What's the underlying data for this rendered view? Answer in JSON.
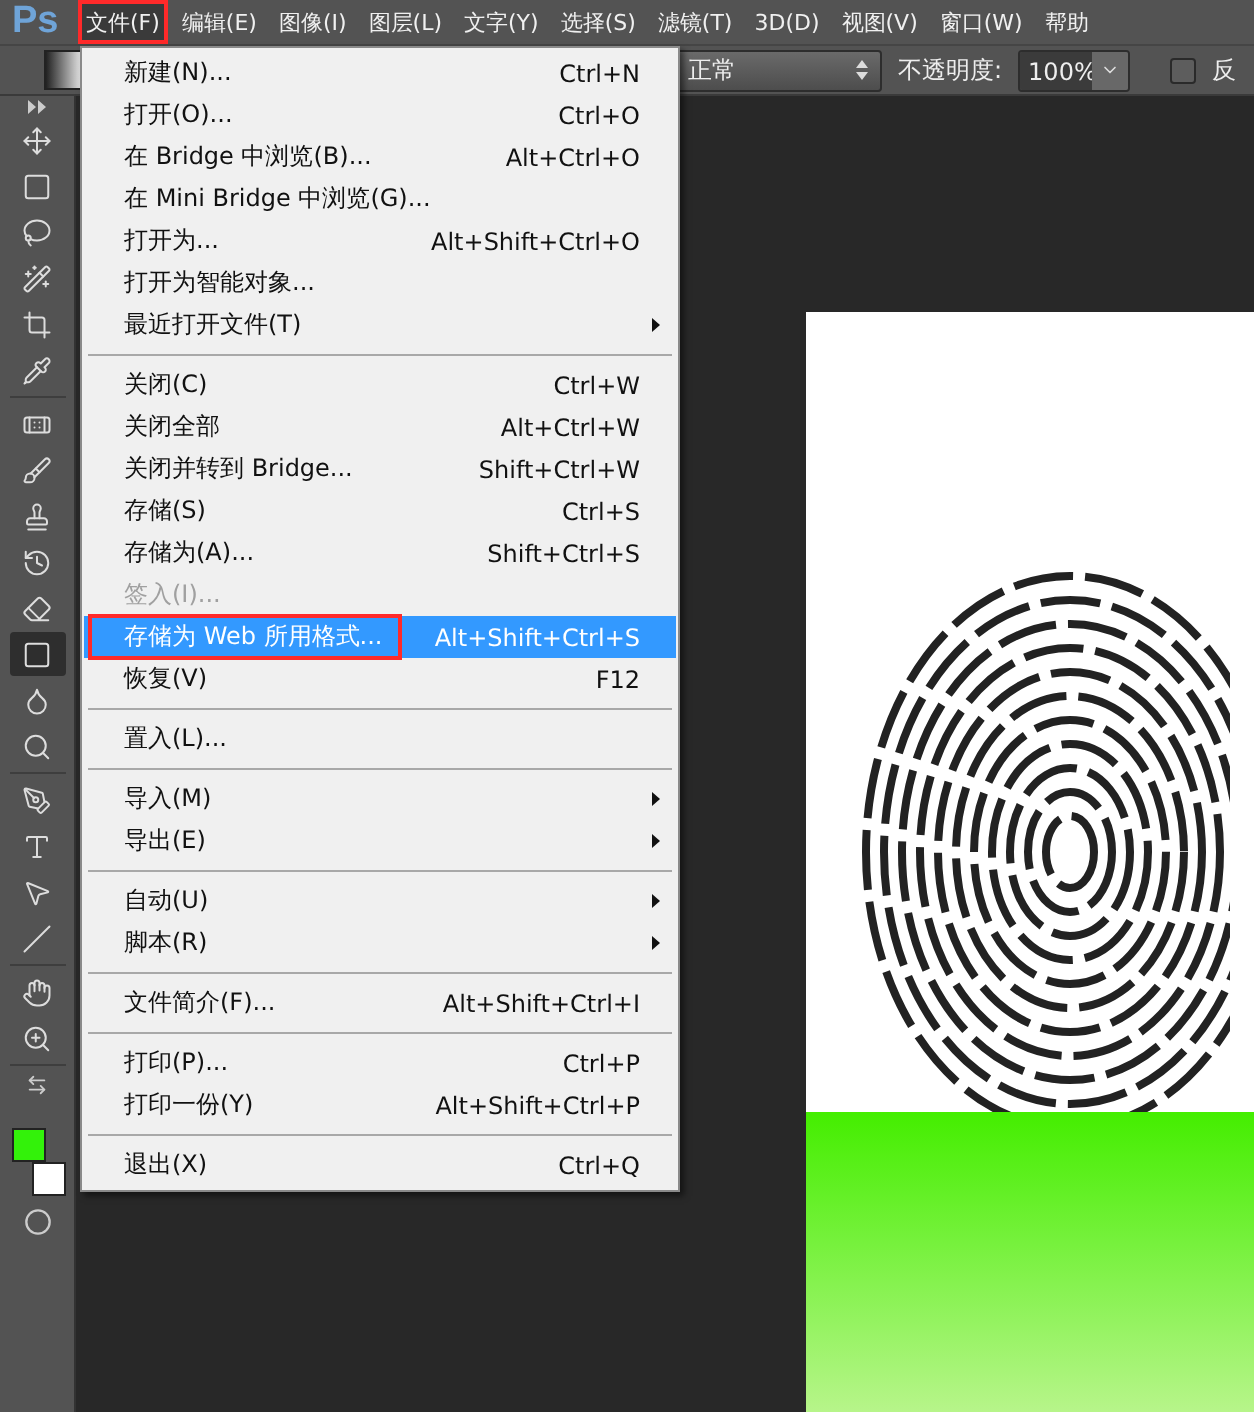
{
  "app": {
    "logo": "Ps"
  },
  "menubar": [
    {
      "label": "文件(F)",
      "selected": true,
      "annotated": true
    },
    {
      "label": "编辑(E)",
      "selected": false,
      "annotated": false
    },
    {
      "label": "图像(I)",
      "selected": false,
      "annotated": false
    },
    {
      "label": "图层(L)",
      "selected": false,
      "annotated": false
    },
    {
      "label": "文字(Y)",
      "selected": false,
      "annotated": false
    },
    {
      "label": "选择(S)",
      "selected": false,
      "annotated": false
    },
    {
      "label": "滤镜(T)",
      "selected": false,
      "annotated": false
    },
    {
      "label": "3D(D)",
      "selected": false,
      "annotated": false
    },
    {
      "label": "视图(V)",
      "selected": false,
      "annotated": false
    },
    {
      "label": "窗口(W)",
      "selected": false,
      "annotated": false
    },
    {
      "label": "帮助",
      "selected": false,
      "annotated": false
    }
  ],
  "options_bar": {
    "blend_mode": "正常",
    "opacity_label": "不透明度:",
    "opacity_value": "100%",
    "reverse_checked": false,
    "reverse_label": "反"
  },
  "file_menu": {
    "groups": [
      [
        {
          "label": "新建(N)...",
          "shortcut": "Ctrl+N",
          "submenu": false,
          "disabled": false,
          "selected": false,
          "annotated": false
        },
        {
          "label": "打开(O)...",
          "shortcut": "Ctrl+O",
          "submenu": false,
          "disabled": false,
          "selected": false,
          "annotated": false
        },
        {
          "label": "在 Bridge 中浏览(B)...",
          "shortcut": "Alt+Ctrl+O",
          "submenu": false,
          "disabled": false,
          "selected": false,
          "annotated": false
        },
        {
          "label": "在 Mini Bridge 中浏览(G)...",
          "submenu": false,
          "disabled": false,
          "selected": false,
          "annotated": false
        },
        {
          "label": "打开为...",
          "shortcut": "Alt+Shift+Ctrl+O",
          "submenu": false,
          "disabled": false,
          "selected": false,
          "annotated": false
        },
        {
          "label": "打开为智能对象...",
          "submenu": false,
          "disabled": false,
          "selected": false,
          "annotated": false
        },
        {
          "label": "最近打开文件(T)",
          "submenu": true,
          "disabled": false,
          "selected": false,
          "annotated": false
        }
      ],
      [
        {
          "label": "关闭(C)",
          "shortcut": "Ctrl+W",
          "submenu": false,
          "disabled": false,
          "selected": false,
          "annotated": false
        },
        {
          "label": "关闭全部",
          "shortcut": "Alt+Ctrl+W",
          "submenu": false,
          "disabled": false,
          "selected": false,
          "annotated": false
        },
        {
          "label": "关闭并转到 Bridge...",
          "shortcut": "Shift+Ctrl+W",
          "submenu": false,
          "disabled": false,
          "selected": false,
          "annotated": false
        },
        {
          "label": "存储(S)",
          "shortcut": "Ctrl+S",
          "submenu": false,
          "disabled": false,
          "selected": false,
          "annotated": false
        },
        {
          "label": "存储为(A)...",
          "shortcut": "Shift+Ctrl+S",
          "submenu": false,
          "disabled": false,
          "selected": false,
          "annotated": false
        },
        {
          "label": "签入(I)...",
          "submenu": false,
          "disabled": true,
          "selected": false,
          "annotated": false
        },
        {
          "label": "存储为 Web 所用格式...",
          "shortcut": "Alt+Shift+Ctrl+S",
          "submenu": false,
          "disabled": false,
          "selected": true,
          "annotated": true
        },
        {
          "label": "恢复(V)",
          "shortcut": "F12",
          "submenu": false,
          "disabled": false,
          "selected": false,
          "annotated": false
        }
      ],
      [
        {
          "label": "置入(L)...",
          "submenu": false,
          "disabled": false,
          "selected": false,
          "annotated": false
        }
      ],
      [
        {
          "label": "导入(M)",
          "submenu": true,
          "disabled": false,
          "selected": false,
          "annotated": false
        },
        {
          "label": "导出(E)",
          "submenu": true,
          "disabled": false,
          "selected": false,
          "annotated": false
        }
      ],
      [
        {
          "label": "自动(U)",
          "submenu": true,
          "disabled": false,
          "selected": false,
          "annotated": false
        },
        {
          "label": "脚本(R)",
          "submenu": true,
          "disabled": false,
          "selected": false,
          "annotated": false
        }
      ],
      [
        {
          "label": "文件简介(F)...",
          "shortcut": "Alt+Shift+Ctrl+I",
          "submenu": false,
          "disabled": false,
          "selected": false,
          "annotated": false
        }
      ],
      [
        {
          "label": "打印(P)...",
          "shortcut": "Ctrl+P",
          "submenu": false,
          "disabled": false,
          "selected": false,
          "annotated": false
        },
        {
          "label": "打印一份(Y)",
          "shortcut": "Alt+Shift+Ctrl+P",
          "submenu": false,
          "disabled": false,
          "selected": false,
          "annotated": false
        }
      ],
      [
        {
          "label": "退出(X)",
          "shortcut": "Ctrl+Q",
          "submenu": false,
          "disabled": false,
          "selected": false,
          "annotated": false
        }
      ]
    ]
  },
  "toolbar": {
    "groups": [
      [
        {
          "selected": false
        },
        {
          "selected": false
        },
        {
          "selected": false
        },
        {
          "selected": false
        },
        {
          "selected": false
        },
        {
          "selected": false
        }
      ],
      [
        {
          "selected": false
        },
        {
          "selected": false
        },
        {
          "selected": false
        },
        {
          "selected": false
        },
        {
          "selected": false
        },
        {
          "selected": true
        },
        {
          "selected": false
        },
        {
          "selected": false
        }
      ],
      [
        {
          "selected": false
        },
        {
          "selected": false
        },
        {
          "selected": false
        },
        {
          "selected": false
        }
      ],
      [
        {
          "selected": false
        },
        {
          "selected": false
        }
      ]
    ]
  }
}
